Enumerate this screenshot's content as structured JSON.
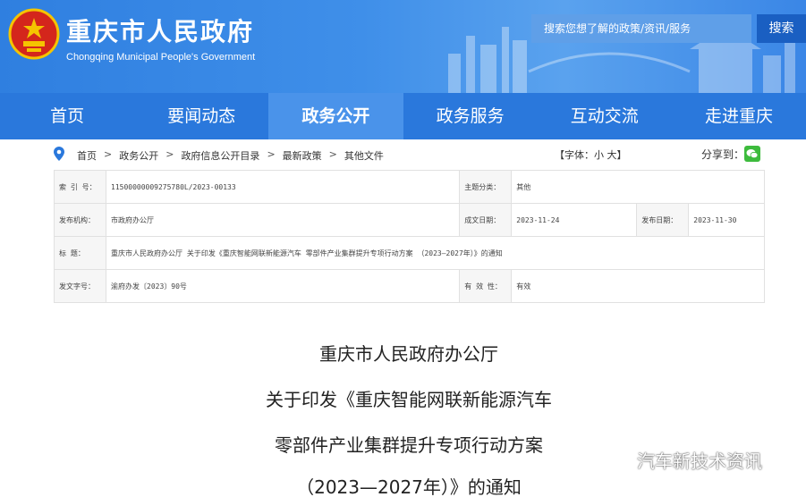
{
  "header": {
    "site_title": "重庆市人民政府",
    "site_subtitle": "Chongqing Municipal People's Government",
    "search_placeholder": "搜索您想了解的政策/资讯/服务",
    "search_button": "搜索"
  },
  "nav": {
    "items": [
      "首页",
      "要闻动态",
      "政务公开",
      "政务服务",
      "互动交流",
      "走进重庆"
    ],
    "active_index": 2
  },
  "breadcrumb": {
    "items": [
      "首页",
      "政务公开",
      "政府信息公开目录",
      "最新政策",
      "其他文件"
    ],
    "separator": ">"
  },
  "font_size": {
    "label": "【字体：",
    "small": "小",
    "large": "大",
    "close": "】"
  },
  "share": {
    "label": "分享到：",
    "icon": "wechat-icon"
  },
  "info": {
    "index_label": "索  引  号：",
    "index_value": "11500000009275780L/2023-00133",
    "category_label": "主题分类：",
    "category_value": "其他",
    "issuer_label": "发布机构：",
    "issuer_value": "市政府办公厅",
    "created_label": "成文日期：",
    "created_value": "2023-11-24",
    "published_label": "发布日期：",
    "published_value": "2023-11-30",
    "title_label": "标      题：",
    "title_value": "重庆市人民政府办公厅 关于印发《重庆智能网联新能源汽车 零部件产业集群提升专项行动方案 （2023—2027年）》的通知",
    "docno_label": "发文字号：",
    "docno_value": "渝府办发〔2023〕90号",
    "validity_label": "有  效  性：",
    "validity_value": "有效"
  },
  "document": {
    "title_lines": [
      "重庆市人民政府办公厅",
      "关于印发《重庆智能网联新能源汽车",
      "零部件产业集群提升专项行动方案",
      "（2023—2027年）》的通知"
    ]
  },
  "watermark": {
    "text": "汽车新技术资讯",
    "icon": "wechat-logo-icon"
  },
  "colors": {
    "header_blue": "#2f7fe0",
    "nav_blue": "#2a78dc",
    "nav_active": "#4a93ea",
    "search_button": "#1a5fc2",
    "emblem_red": "#d4261c",
    "emblem_gold": "#f5c400"
  }
}
